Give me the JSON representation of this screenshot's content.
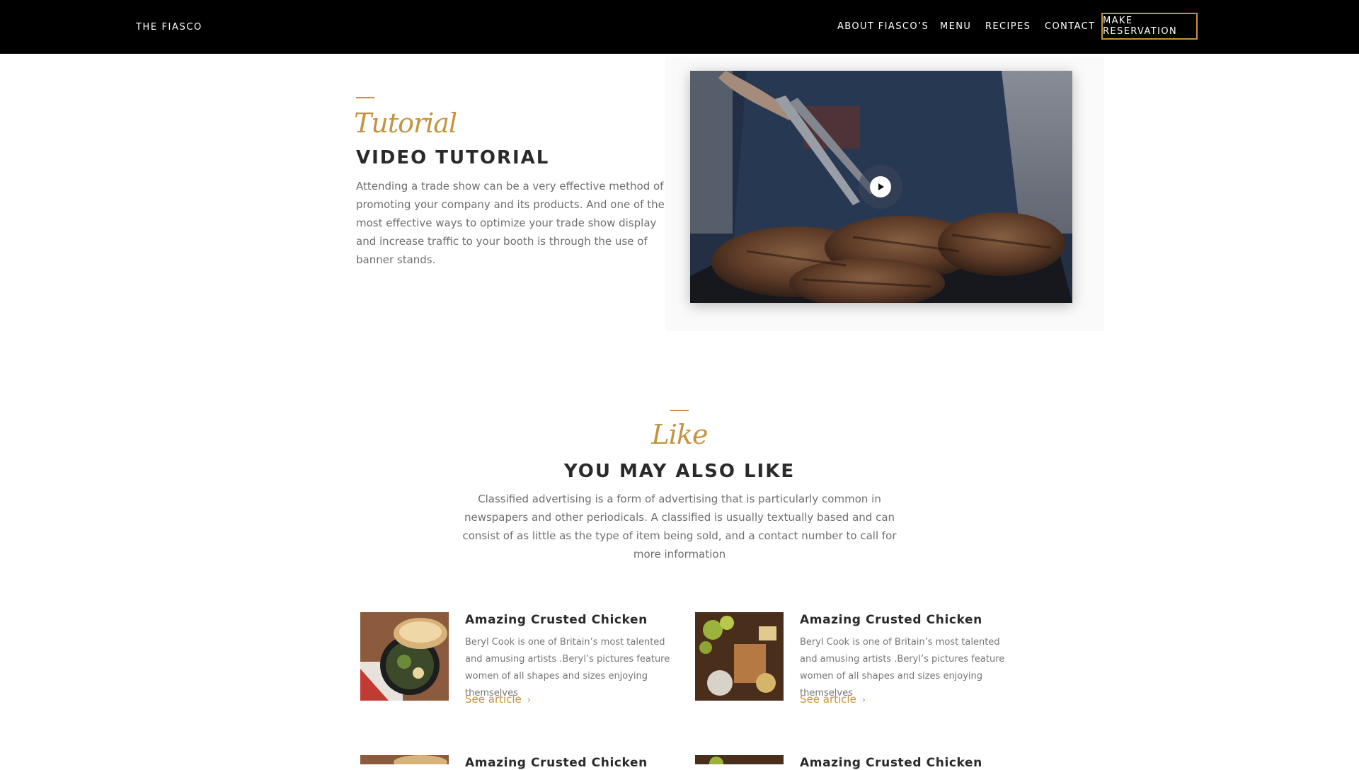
{
  "nav": {
    "brand": "THE FIASCO",
    "links": [
      "ABOUT FIASCO’S",
      "MENU",
      "RECIPES",
      "CONTACT"
    ],
    "reservation": "MAKE RESERVATION"
  },
  "tutorial": {
    "script": "Tutorial",
    "heading": "VIDEO TUTORIAL",
    "text": "Attending a trade show can be a very effective method of promoting your company and its products. And one of the most effective ways to optimize your trade show display and increase traffic to your booth is through the use of banner stands."
  },
  "like": {
    "script": "Like",
    "heading": "YOU MAY ALSO LIKE",
    "text": "Classified advertising is a form of advertising that is particularly common in newspapers and other periodicals. A classified is usually textually based and can consist of as little as the type of item being sold, and a contact number to call for more information"
  },
  "articles": [
    {
      "title": "Amazing Crusted Chicken",
      "desc": "Beryl Cook is one of Britain’s most talented and amusing artists .Beryl’s pictures feature women of all shapes and sizes enjoying themselves",
      "link": "See article"
    },
    {
      "title": "Amazing Crusted Chicken",
      "desc": "Beryl Cook is one of Britain’s most talented and amusing artists .Beryl’s pictures feature women of all shapes and sizes enjoying themselves",
      "link": "See article"
    },
    {
      "title": "Amazing Crusted Chicken",
      "desc": "",
      "link": ""
    },
    {
      "title": "Amazing Crusted Chicken",
      "desc": "",
      "link": ""
    }
  ],
  "colors": {
    "accent": "#c4943f",
    "nav_bg": "#000000",
    "heading": "#2a2a2a",
    "body_text": "#6f6f6f"
  },
  "icons": {
    "play": "play-icon",
    "chevron": "chevron-right-icon"
  }
}
